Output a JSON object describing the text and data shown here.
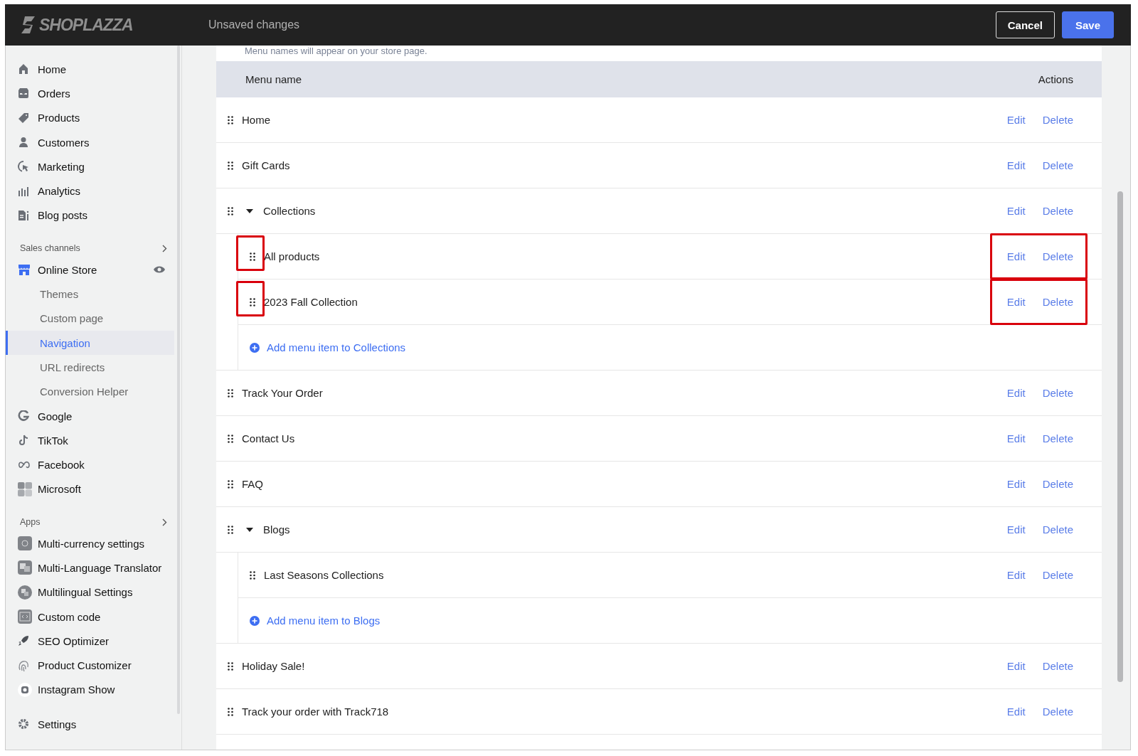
{
  "top_bar": {
    "logo": "SHOPLAZZA",
    "title": "Unsaved changes",
    "buttons": [
      {
        "label": "Cancel",
        "kind": "secondary"
      },
      {
        "label": "Save",
        "kind": "primary"
      }
    ]
  },
  "sidebar": {
    "main_items": [
      {
        "label": "Home"
      },
      {
        "label": "Orders"
      },
      {
        "label": "Products"
      },
      {
        "label": "Customers"
      },
      {
        "label": "Marketing"
      },
      {
        "label": "Analytics"
      },
      {
        "label": "Blog posts"
      }
    ],
    "sales_channels": {
      "title": "Sales channels",
      "channel": {
        "label": "Online Store",
        "sub_items": [
          {
            "label": "Themes",
            "selected": false
          },
          {
            "label": "Custom page",
            "selected": false
          },
          {
            "label": "Navigation",
            "selected": true
          },
          {
            "label": "URL redirects",
            "selected": false
          },
          {
            "label": "Conversion Helper",
            "selected": false
          }
        ]
      },
      "others": [
        {
          "label": "Google"
        },
        {
          "label": "TikTok"
        },
        {
          "label": "Facebook"
        },
        {
          "label": "Microsoft"
        }
      ]
    },
    "apps": {
      "title": "Apps",
      "items": [
        {
          "label": "Multi-currency settings"
        },
        {
          "label": "Multi-Language Translator"
        },
        {
          "label": "Multilingual Settings"
        },
        {
          "label": "Custom code"
        },
        {
          "label": "SEO Optimizer"
        },
        {
          "label": "Product Customizer"
        },
        {
          "label": "Instagram Show"
        }
      ]
    },
    "footer_item": {
      "label": "Settings"
    }
  },
  "menu": {
    "hint": "Menu names will appear on your store page.",
    "columns": [
      "Menu name",
      "Actions"
    ],
    "items": [
      {
        "name": "Home",
        "actions": [
          "Edit",
          "Delete"
        ],
        "highlighted": false
      },
      {
        "name": "Gift Cards",
        "actions": [
          "Edit",
          "Delete"
        ],
        "highlighted": false
      },
      {
        "name": "Collections",
        "actions": [
          "Edit",
          "Delete"
        ],
        "highlighted": false,
        "expanded": true,
        "children": [
          {
            "name": "All products",
            "actions": [
              "Edit",
              "Delete"
            ],
            "highlighted": true
          },
          {
            "name": "2023 Fall Collection",
            "actions": [
              "Edit",
              "Delete"
            ],
            "highlighted": true
          }
        ],
        "add_link": "Add menu item to Collections"
      },
      {
        "name": "Track Your Order",
        "actions": [
          "Edit",
          "Delete"
        ],
        "highlighted": false
      },
      {
        "name": "Contact Us",
        "actions": [
          "Edit",
          "Delete"
        ],
        "highlighted": false
      },
      {
        "name": "FAQ",
        "actions": [
          "Edit",
          "Delete"
        ],
        "highlighted": false
      },
      {
        "name": "Blogs",
        "actions": [
          "Edit",
          "Delete"
        ],
        "highlighted": false,
        "expanded": true,
        "children": [
          {
            "name": "Last Seasons Collections",
            "actions": [
              "Edit",
              "Delete"
            ],
            "highlighted": false
          }
        ],
        "add_link": "Add menu item to Blogs"
      },
      {
        "name": "Holiday Sale!",
        "actions": [
          "Edit",
          "Delete"
        ],
        "highlighted": false
      },
      {
        "name": "Track your order with Track718",
        "actions": [
          "Edit",
          "Delete"
        ],
        "highlighted": false
      }
    ]
  }
}
